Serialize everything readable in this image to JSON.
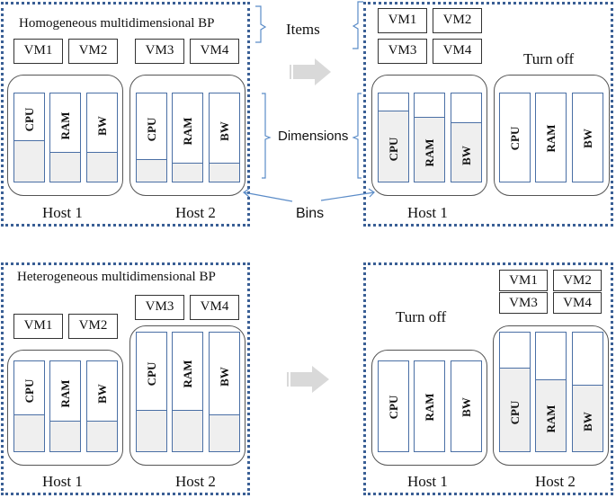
{
  "panels": {
    "top_left": {
      "title": "Homogeneous multidimensional BP",
      "vms": [
        "VM1",
        "VM2",
        "VM3",
        "VM4"
      ],
      "hosts": [
        {
          "label": "Host 1",
          "dims": [
            {
              "name": "CPU",
              "used": 0.46
            },
            {
              "name": "RAM",
              "used": 0.33
            },
            {
              "name": "BW",
              "used": 0.33
            }
          ]
        },
        {
          "label": "Host 2",
          "dims": [
            {
              "name": "CPU",
              "used": 0.25
            },
            {
              "name": "RAM",
              "used": 0.2
            },
            {
              "name": "BW",
              "used": 0.2
            }
          ]
        }
      ]
    },
    "top_right": {
      "vms": [
        "VM1",
        "VM2",
        "VM3",
        "VM4"
      ],
      "turn_off": "Turn off",
      "hosts": [
        {
          "label": "Host 1",
          "dims": [
            {
              "name": "CPU",
              "used": 0.8
            },
            {
              "name": "RAM",
              "used": 0.72
            },
            {
              "name": "BW",
              "used": 0.66
            }
          ]
        },
        {
          "label": "",
          "dims": [
            {
              "name": "CPU",
              "used": 0
            },
            {
              "name": "RAM",
              "used": 0
            },
            {
              "name": "BW",
              "used": 0
            }
          ]
        }
      ]
    },
    "bottom_left": {
      "title": "Heterogeneous multidimensional BP",
      "vms": [
        "VM1",
        "VM2",
        "VM3",
        "VM4"
      ],
      "hosts": [
        {
          "label": "Host 1",
          "dims": [
            {
              "name": "CPU",
              "used": 0.4
            },
            {
              "name": "RAM",
              "used": 0.33
            },
            {
              "name": "BW",
              "used": 0.33
            }
          ]
        },
        {
          "label": "Host 2",
          "dims": [
            {
              "name": "CPU",
              "used": 0.34
            },
            {
              "name": "RAM",
              "used": 0.34
            },
            {
              "name": "BW",
              "used": 0.3
            }
          ]
        }
      ]
    },
    "bottom_right": {
      "vms": [
        "VM1",
        "VM2",
        "VM3",
        "VM4"
      ],
      "turn_off": "Turn off",
      "hosts": [
        {
          "label": "Host 1",
          "dims": [
            {
              "name": "CPU",
              "used": 0
            },
            {
              "name": "RAM",
              "used": 0
            },
            {
              "name": "BW",
              "used": 0
            }
          ]
        },
        {
          "label": "Host 2",
          "dims": [
            {
              "name": "CPU",
              "used": 0.7
            },
            {
              "name": "RAM",
              "used": 0.6
            },
            {
              "name": "BW",
              "used": 0.55
            }
          ]
        }
      ]
    }
  },
  "annotations": {
    "items": "Items",
    "dimensions": "Dimensions",
    "bins": "Bins"
  },
  "colors": {
    "panel_border": "#3a5f95",
    "bar_border": "#4a6fa5",
    "fill": "#efefef",
    "arrow": "#d9d9d9",
    "annotation": "#5b8cc8"
  }
}
